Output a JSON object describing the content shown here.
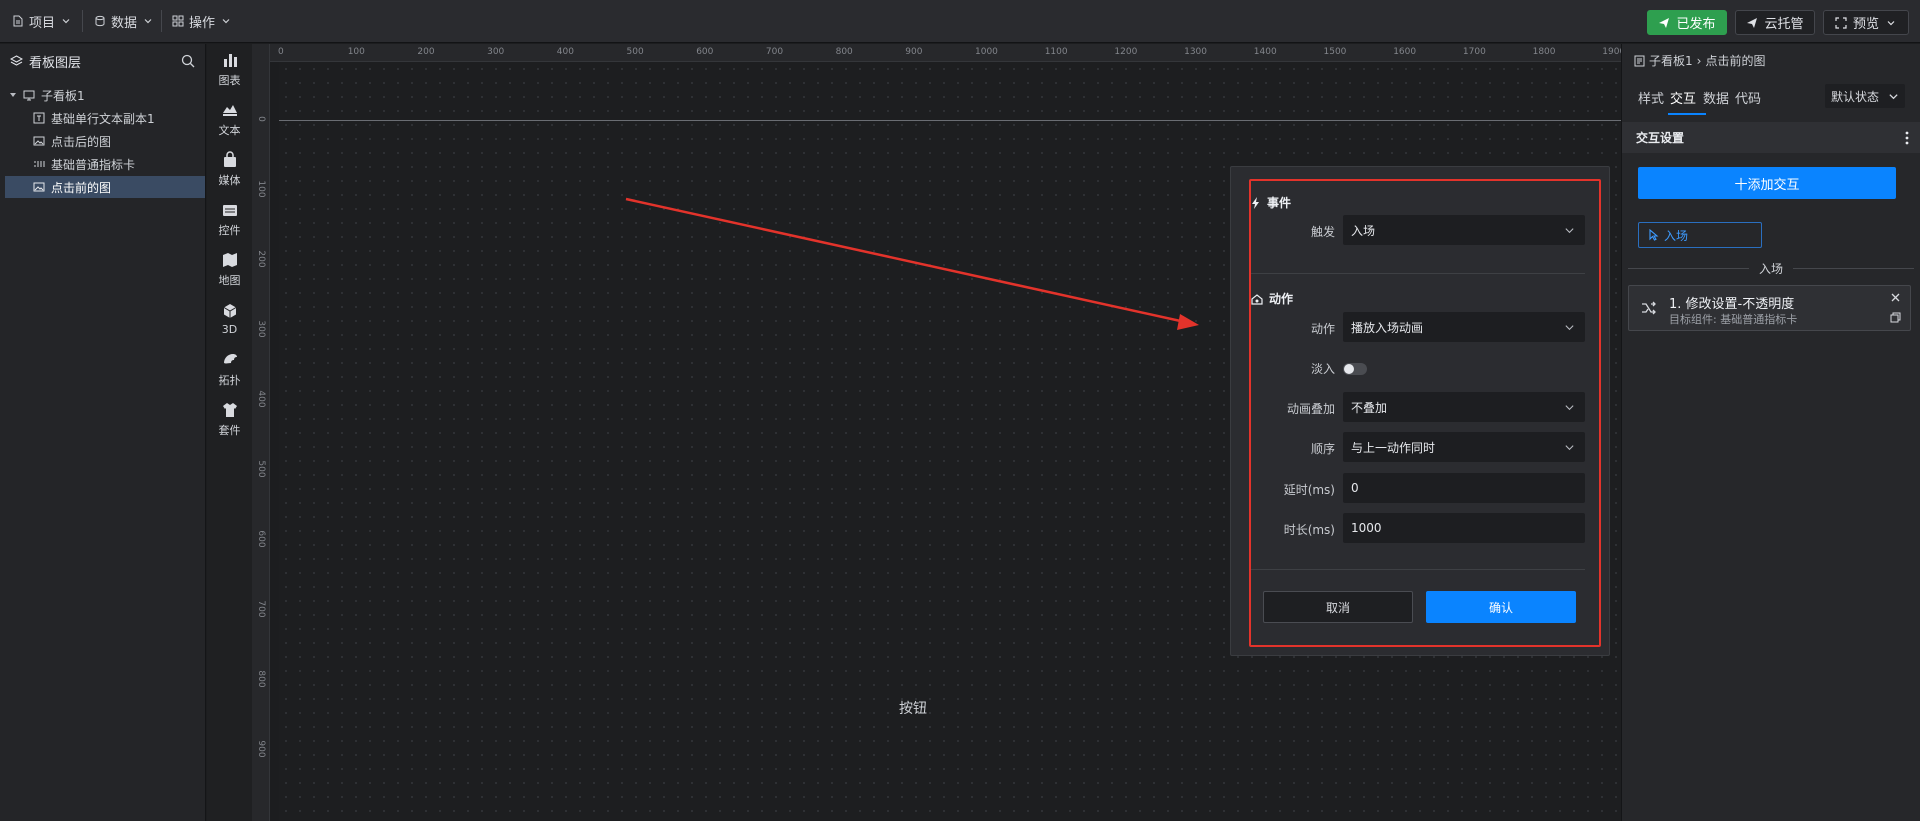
{
  "topbar": {
    "menus": [
      {
        "label": "项目",
        "icon": "file-icon"
      },
      {
        "label": "数据",
        "icon": "database-icon"
      },
      {
        "label": "操作",
        "icon": "grid-icon"
      }
    ],
    "publish_label": "已发布",
    "cloud_label": "云托管",
    "preview_label": "预览"
  },
  "layers": {
    "title": "看板图层",
    "root": "子看板1",
    "items": [
      {
        "label": "基础单行文本副本1",
        "icon": "text-icon"
      },
      {
        "label": "点击后的图",
        "icon": "image-icon"
      },
      {
        "label": "基础普通指标卡",
        "icon": "metric-icon"
      },
      {
        "label": "点击前的图",
        "icon": "image-icon",
        "selected": true
      }
    ]
  },
  "components": [
    "图表",
    "文本",
    "媒体",
    "控件",
    "地图",
    "3D",
    "拓扑",
    "套件"
  ],
  "ruler": {
    "top": [
      "0",
      "100",
      "200",
      "300",
      "400",
      "500",
      "600",
      "700",
      "800",
      "900",
      "1000",
      "1100",
      "1200",
      "1300",
      "1400",
      "1500",
      "1600",
      "1700",
      "1800",
      "1900"
    ],
    "left": [
      "0",
      "100",
      "200",
      "300",
      "400",
      "500",
      "600",
      "700",
      "800",
      "900"
    ]
  },
  "canvas": {
    "button_text": "按钮"
  },
  "modal": {
    "event_title": "事件",
    "trigger_label": "触发",
    "trigger_value": "入场",
    "action_title": "动作",
    "action_label": "动作",
    "action_value": "播放入场动画",
    "fade_label": "淡入",
    "fade_on": false,
    "overlay_label": "动画叠加",
    "overlay_value": "不叠加",
    "order_label": "顺序",
    "order_value": "与上一动作同时",
    "delay_label": "延时(ms)",
    "delay_value": "0",
    "duration_label": "时长(ms)",
    "duration_value": "1000",
    "cancel_label": "取消",
    "confirm_label": "确认"
  },
  "right": {
    "breadcrumb_parent": "子看板1",
    "breadcrumb_current": "点击前的图",
    "tabs": [
      "样式",
      "交互",
      "数据",
      "代码"
    ],
    "active_tab": "交互",
    "state": "默认状态",
    "section_title": "交互设置",
    "add_label": "十添加交互",
    "tag_label": "入场",
    "divider_label": "入场",
    "card_title": "1. 修改设置-不透明度",
    "card_sub": "目标组件: 基础普通指标卡"
  },
  "colors": {
    "accent": "#0a84ff",
    "publish_green": "#2e9f4f",
    "highlight_red": "#e3332b"
  }
}
